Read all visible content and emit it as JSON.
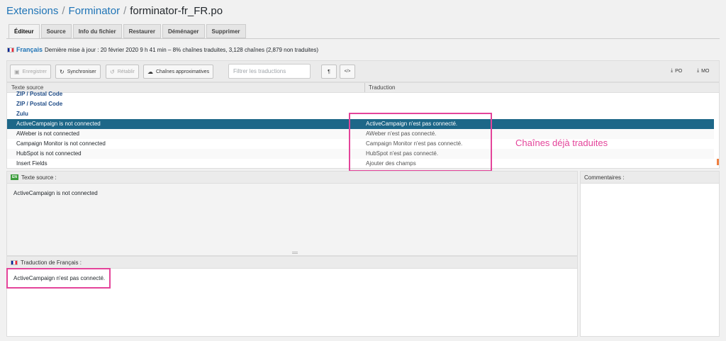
{
  "breadcrumb": {
    "items": [
      "Extensions",
      "Forminator"
    ],
    "separator": "/",
    "current": "forminator-fr_FR.po"
  },
  "tabs": [
    {
      "label": "Éditeur"
    },
    {
      "label": "Source"
    },
    {
      "label": "Info du fichier"
    },
    {
      "label": "Restaurer"
    },
    {
      "label": "Déménager"
    },
    {
      "label": "Supprimer"
    }
  ],
  "stats": {
    "locale": "Français",
    "text": "Dernière mise à jour : 20 février 2020 9 h 41 min – 8% chaînes traduites, 3,128 chaînes (2,879 non traduites)"
  },
  "toolbar": {
    "save": "Enregistrer",
    "sync": "Synchroniser",
    "revert": "Rétablir",
    "fuzzy": "Chaînes approximatives",
    "filter_placeholder": "Filtrer les traductions",
    "pilcrow": "¶",
    "code": "</>",
    "po": "PO",
    "mo": "MO"
  },
  "list": {
    "col_source": "Texte source",
    "col_translation": "Traduction",
    "rows": [
      {
        "source": "ZIP / Postal Code",
        "translation": "",
        "group": true
      },
      {
        "source": "ZIP / Postal Code",
        "translation": "",
        "group": true
      },
      {
        "source": "Zulu",
        "translation": "",
        "group": true
      },
      {
        "source": "ActiveCampaign is not connected",
        "translation": "ActiveCampaign n'est pas connecté.",
        "selected": true
      },
      {
        "source": "AWeber is not connected",
        "translation": "AWeber n'est pas connecté."
      },
      {
        "source": "Campaign Monitor is not connected",
        "translation": "Campaign Monitor n'est pas connecté."
      },
      {
        "source": "HubSpot is not connected",
        "translation": "HubSpot n'est pas connecté."
      },
      {
        "source": "Insert Fields",
        "translation": "Ajouter des champs"
      }
    ]
  },
  "annotation": {
    "label": "Chaînes déjà traduites",
    "color": "#e4449a"
  },
  "source_panel": {
    "badge": "EN",
    "title": "Texte source :",
    "text": "ActiveCampaign is not connected"
  },
  "translation_panel": {
    "title": "Traduction de Français :",
    "text": "ActiveCampaign n'est pas connecté."
  },
  "comments_panel": {
    "title": "Commentaires :"
  }
}
